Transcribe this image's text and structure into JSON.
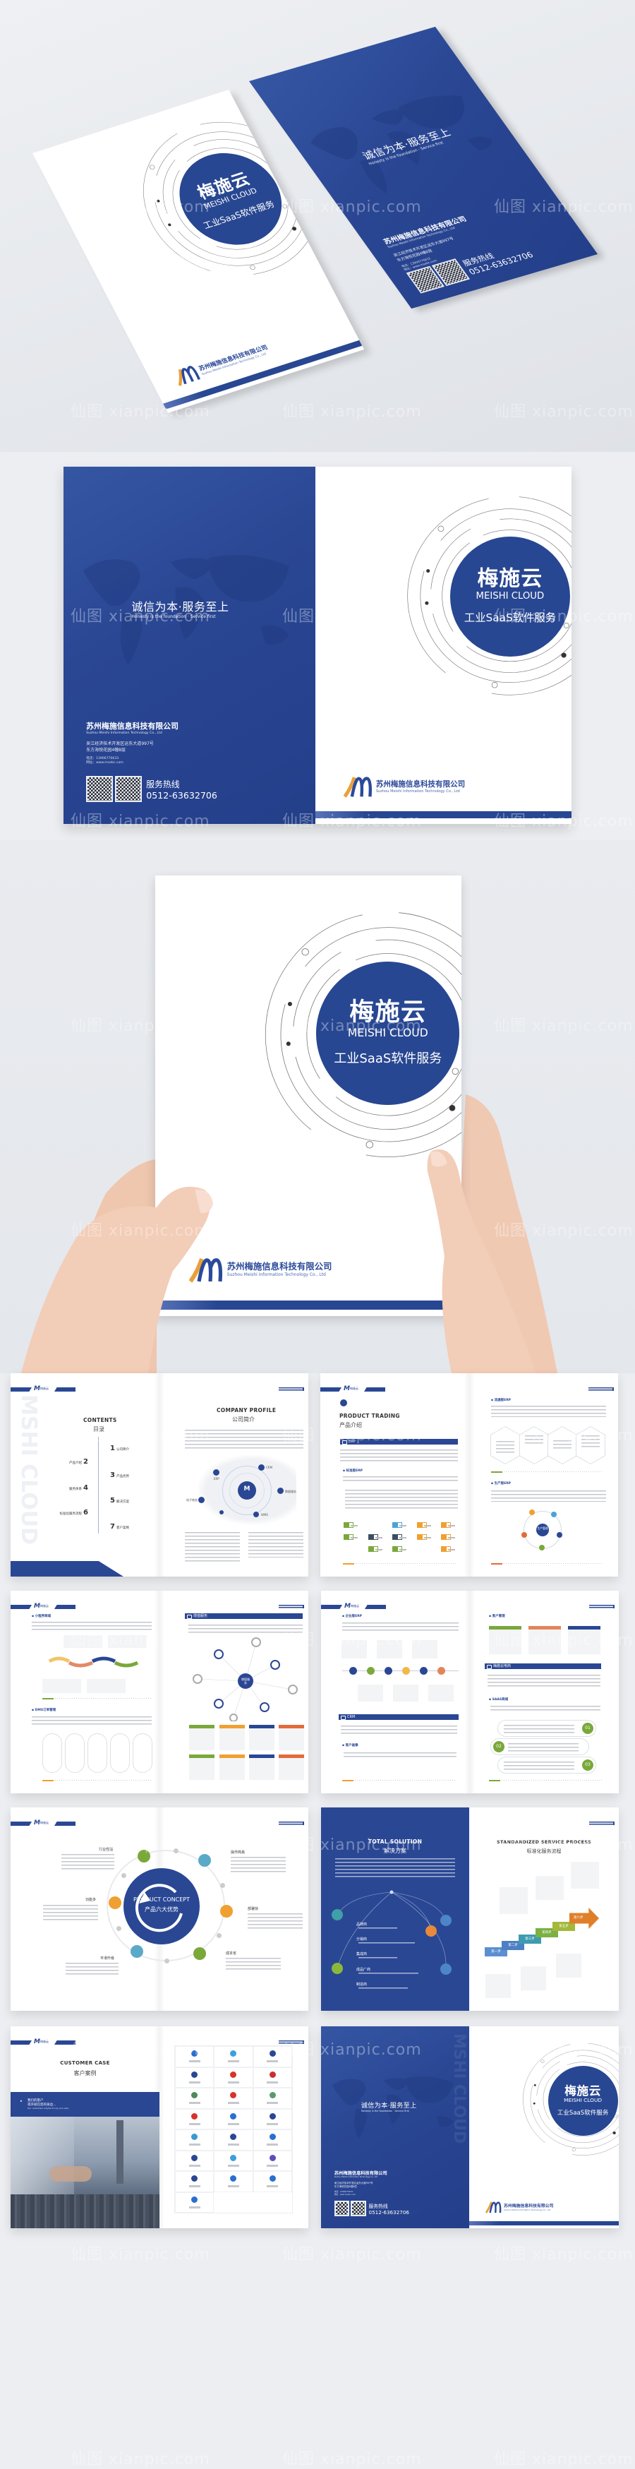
{
  "watermark": "仙图 xianpic.com",
  "brand": {
    "name": "梅施云",
    "name_en": "MEISHI CLOUD",
    "tagline": "工业SaaS软件服务",
    "header_logo": "梅施云",
    "vertical_mark": "MSHI CLOUD"
  },
  "company": {
    "name": "苏州梅施信息科技有限公司",
    "name_en": "Suzhou Meishi Information Technology Co., Ltd",
    "address_1": "吴江经济技术开发区运东大道997号",
    "address_2": "东方海悦花园4幢8层",
    "phone": "电话：13906776633",
    "website": "网址：www.msebc.com",
    "hotline_label": "服务热线",
    "hotline": "0512-63632706"
  },
  "slogan": {
    "cn": "诚信为本·服务至上",
    "en": "Honesty is the foundation · Service first"
  },
  "contents": {
    "title": "CONTENTS",
    "title_cn": "目录",
    "items": [
      {
        "num": "1",
        "label": "公司简介"
      },
      {
        "num": "2",
        "label": "产品介绍"
      },
      {
        "num": "3",
        "label": "产品优势"
      },
      {
        "num": "4",
        "label": "服务体系"
      },
      {
        "num": "5",
        "label": "解决方案"
      },
      {
        "num": "6",
        "label": "标准化服务流程"
      },
      {
        "num": "7",
        "label": "客户案例"
      }
    ]
  },
  "company_profile": {
    "title": "COMPANY PROFILE",
    "title_cn": "公司简介",
    "center": "梅施云",
    "nodes": [
      "ERP",
      "CRM",
      "数据服务",
      "WMS",
      "电子商务"
    ]
  },
  "product_trading": {
    "title": "PRODUCT TRADING",
    "title_cn": "产品介绍",
    "erp_bar": "ERP",
    "standard_erp": "标准版ERP",
    "circulation_erp": "流通版ERP",
    "production_erp": "生产版ERP",
    "center": "生产管理"
  },
  "services": {
    "mini_mall": "小程序商城",
    "value_added": "增值服务",
    "value_center": "增值服务",
    "dms": "DMS订单管理",
    "enterprise_erp": "企业版ERP",
    "crm": "CRM",
    "customer_profile": "客户画像",
    "customer_mgmt": "客户管理",
    "ecommerce": "梅施云电商",
    "saas_mall": "SAAS商城",
    "steps": [
      "01",
      "02",
      "03"
    ]
  },
  "concept": {
    "title": "PRODUCT CONCEPT",
    "title_cn": "产品六大优势",
    "items": [
      "行业性强",
      "操作简易",
      "部署快",
      "成本省",
      "平滑升级",
      "功能多"
    ]
  },
  "solution": {
    "title": "TOTAL SOLUTION",
    "title_cn": "解决方案",
    "items": [
      "品牌商",
      "分销商",
      "集成商",
      "成品厂商",
      "制造商"
    ]
  },
  "process": {
    "title": "STANDARDIZED SERVICE PROCESS",
    "title_cn": "标准化服务流程",
    "steps": [
      "第一步",
      "第二步",
      "第三步",
      "第四步",
      "第五步",
      "第六步"
    ]
  },
  "customer_case": {
    "title": "CUSTOMER CASE",
    "title_cn": "客户案例",
    "banner_1": "我们的客户",
    "banner_2": "或许就在您的身边...",
    "banner_en": "Our customers maybe it's by your side"
  },
  "colors": {
    "brand_blue": "#284792",
    "accent_orange": "#e9a03b",
    "accent_green": "#7aa83a",
    "accent_teal": "#5aa9c9",
    "accent_red": "#e36b3a",
    "background": "#eceef1"
  }
}
